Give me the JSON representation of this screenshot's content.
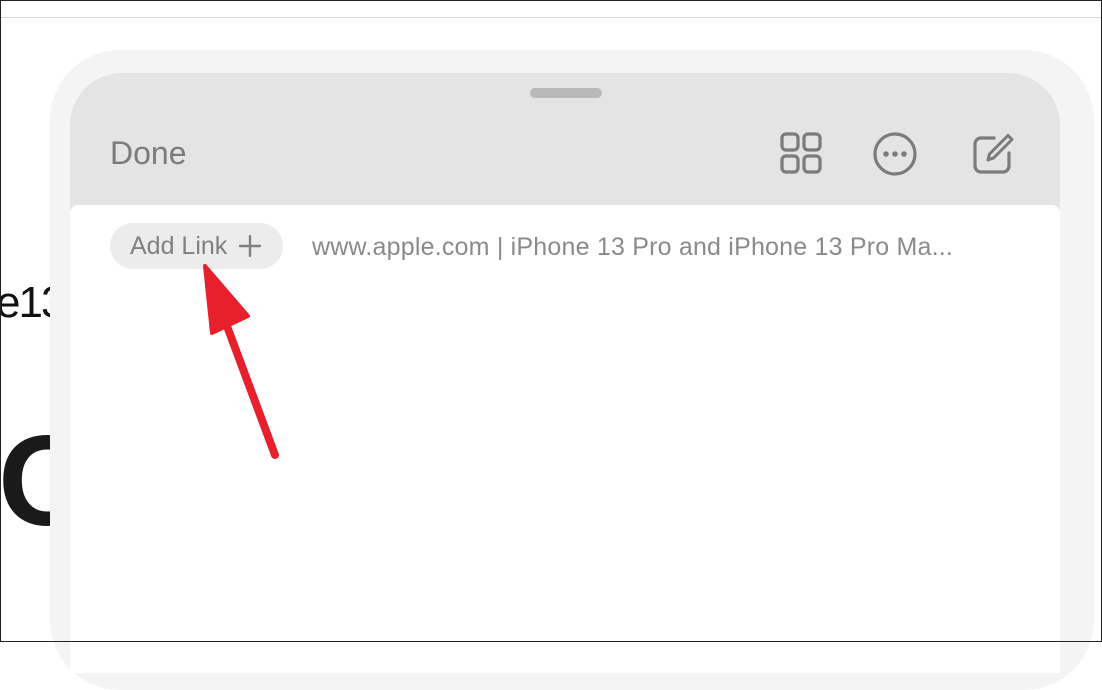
{
  "background": {
    "partial_text_1": "e13",
    "partial_text_2": "O"
  },
  "sheet": {
    "done_label": "Done",
    "toolbar": {
      "icons": [
        "grid-icon",
        "more-icon",
        "compose-icon"
      ]
    },
    "add_link_label": "Add Link",
    "link_title": "www.apple.com | iPhone 13 Pro and iPhone 13 Pro Ma..."
  },
  "annotation": {
    "arrow_color": "#e8202c"
  },
  "colors": {
    "sheet_bg": "#e4e4e4",
    "content_bg": "#ffffff",
    "muted_text": "#7b7b7b"
  }
}
